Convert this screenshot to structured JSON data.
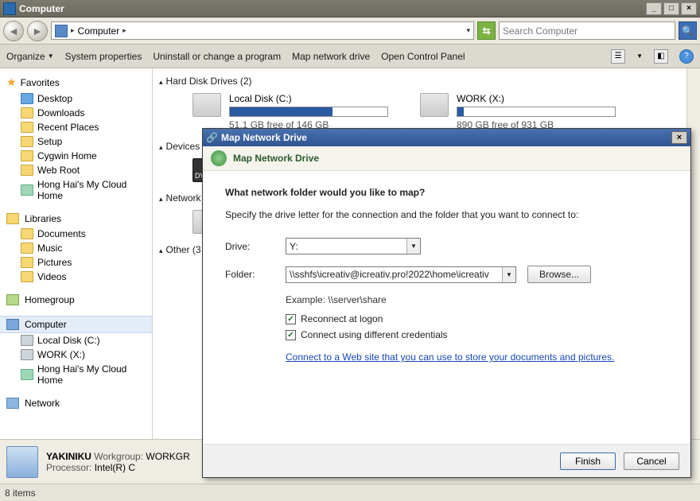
{
  "window": {
    "title": "Computer"
  },
  "nav": {
    "breadcrumb_root": "Computer",
    "search_placeholder": "Search Computer"
  },
  "cmdbar": {
    "organize": "Organize",
    "sysprops": "System properties",
    "uninstall": "Uninstall or change a program",
    "mapdrive": "Map network drive",
    "controlpanel": "Open Control Panel"
  },
  "sidebar": {
    "favorites": "Favorites",
    "fav_items": [
      "Desktop",
      "Downloads",
      "Recent Places",
      "Setup",
      "Cygwin Home",
      "Web Root",
      "Hong Hai's My Cloud Home"
    ],
    "libraries": "Libraries",
    "lib_items": [
      "Documents",
      "Music",
      "Pictures",
      "Videos"
    ],
    "homegroup": "Homegroup",
    "computer": "Computer",
    "comp_items": [
      "Local Disk (C:)",
      "WORK (X:)",
      "Hong Hai's My Cloud Home"
    ],
    "network": "Network"
  },
  "content": {
    "group_hdd": "Hard Disk Drives (2)",
    "drives": [
      {
        "name": "Local Disk (C:)",
        "free": "51.1 GB free of 146 GB",
        "pct": 65
      },
      {
        "name": "WORK (X:)",
        "free": "890 GB free of 931 GB",
        "pct": 4
      }
    ],
    "group_dev": "Devices",
    "group_net": "Network",
    "group_other": "Other (3"
  },
  "details": {
    "name": "YAKINIKU",
    "workgroup_label": "Workgroup:",
    "workgroup": "WORKGR",
    "proc_label": "Processor:",
    "proc": "Intel(R) C"
  },
  "status": {
    "text": "8 items"
  },
  "dialog": {
    "title": "Map Network Drive",
    "header": "Map Network Drive",
    "question": "What network folder would you like to map?",
    "desc": "Specify the drive letter for the connection and the folder that you want to connect to:",
    "drive_label": "Drive:",
    "drive_value": "Y:",
    "folder_label": "Folder:",
    "folder_value": "\\\\sshfs\\icreativ@icreativ.pro!2022\\home\\icreativ",
    "browse": "Browse...",
    "example": "Example: \\\\server\\share",
    "reconnect": "Reconnect at logon",
    "diffcreds": "Connect using different credentials",
    "weblink": "Connect to a Web site that you can use to store your documents and pictures.",
    "finish": "Finish",
    "cancel": "Cancel"
  }
}
